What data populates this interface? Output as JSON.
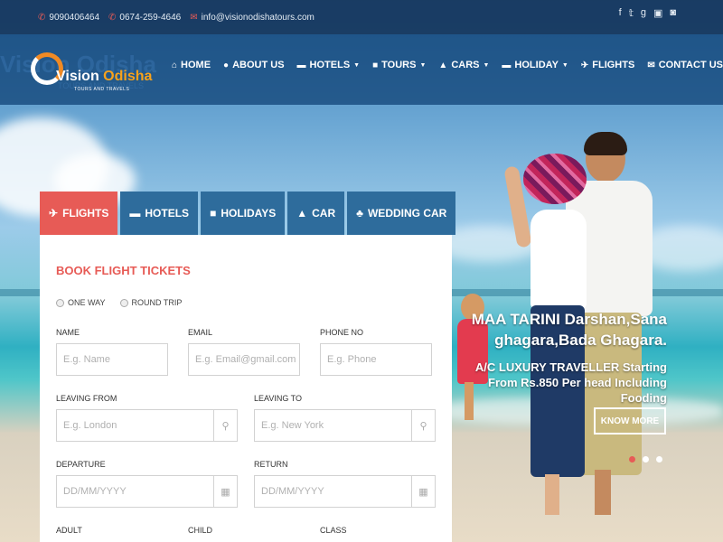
{
  "topbar": {
    "phone1": "9090406464",
    "phone2": "0674-259-4646",
    "email": "info@visionodishatours.com",
    "social": [
      "facebook-icon",
      "twitter-icon",
      "google-plus-icon",
      "youtube-icon",
      "instagram-icon"
    ]
  },
  "logo": {
    "name_part1": "Vision",
    "name_part2": "Odisha",
    "tagline": "TOURS AND TRAVELS",
    "ghost_name": "Vision Odisha",
    "ghost_tagline": "TOURS AND TRAVELS"
  },
  "nav": {
    "items": [
      {
        "label": "HOME",
        "icon": "home-icon",
        "dropdown": false
      },
      {
        "label": "ABOUT US",
        "icon": "user-icon",
        "dropdown": false
      },
      {
        "label": "HOTELS",
        "icon": "bed-icon",
        "dropdown": true
      },
      {
        "label": "TOURS",
        "icon": "briefcase-icon",
        "dropdown": true
      },
      {
        "label": "CARS",
        "icon": "car-icon",
        "dropdown": true
      },
      {
        "label": "HOLIDAY",
        "icon": "bed-icon",
        "dropdown": true
      },
      {
        "label": "FLIGHTS",
        "icon": "plane-icon",
        "dropdown": false
      },
      {
        "label": "CONTACT US",
        "icon": "envelope-icon",
        "dropdown": false
      }
    ]
  },
  "hero": {
    "headline": "MAA TARINI Darshan,Sana ghagara,Bada Ghagara.",
    "description": "A/C LUXURY TRAVELLER Starting From Rs.850 Per head Including Fooding",
    "cta": "KNOW MORE",
    "active_slide": 1,
    "slide_count": 3
  },
  "booking": {
    "tabs": [
      {
        "label": "FLIGHTS",
        "icon": "plane-icon",
        "active": true
      },
      {
        "label": "HOTELS",
        "icon": "bed-icon",
        "active": false
      },
      {
        "label": "HOLIDAYS",
        "icon": "briefcase-icon",
        "active": false
      },
      {
        "label": "CAR",
        "icon": "car-icon",
        "active": false
      },
      {
        "label": "WEDDING CAR",
        "icon": "users-icon",
        "active": false
      }
    ],
    "title": "BOOK FLIGHT TICKETS",
    "trip_types": [
      "ONE WAY",
      "ROUND TRIP"
    ],
    "fields": {
      "name": {
        "label": "NAME",
        "placeholder": "E.g. Name"
      },
      "email": {
        "label": "EMAIL",
        "placeholder": "E.g. Email@gmail.com"
      },
      "phone": {
        "label": "PHONE NO",
        "placeholder": "E.g. Phone"
      },
      "leaving_from": {
        "label": "LEAVING FROM",
        "placeholder": "E.g. London"
      },
      "leaving_to": {
        "label": "LEAVING TO",
        "placeholder": "E.g. New York"
      },
      "departure": {
        "label": "DEPARTURE",
        "placeholder": "DD/MM/YYYY"
      },
      "return": {
        "label": "RETURN",
        "placeholder": "DD/MM/YYYY"
      },
      "adult": {
        "label": "ADULT"
      },
      "child": {
        "label": "CHILD"
      },
      "class": {
        "label": "CLASS"
      }
    }
  },
  "colors": {
    "accent": "#e75b56",
    "tab_blue": "#2e6c9c",
    "topbar": "#16365c",
    "logo_orange": "#f7a21c"
  }
}
